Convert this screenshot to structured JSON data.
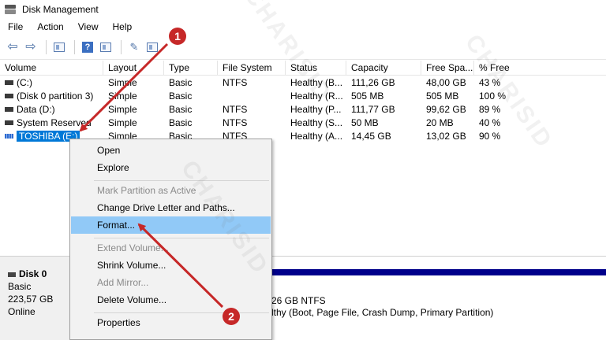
{
  "window": {
    "title": "Disk Management"
  },
  "menu": [
    "File",
    "Action",
    "View",
    "Help"
  ],
  "toolbar": {
    "buttons": [
      "back-arrow-icon",
      "forward-arrow-icon",
      "console-tree-icon",
      "help-icon",
      "properties-icon",
      "rescan-icon",
      "list-view-icon"
    ]
  },
  "columns": [
    "Volume",
    "Layout",
    "Type",
    "File System",
    "Status",
    "Capacity",
    "Free Spa...",
    "% Free"
  ],
  "rows": [
    {
      "volume": "(C:)",
      "layout": "Simple",
      "type": "Basic",
      "fs": "NTFS",
      "status": "Healthy (B...",
      "capacity": "111,26 GB",
      "free": "48,00 GB",
      "pct": "43 %"
    },
    {
      "volume": "(Disk 0 partition 3)",
      "layout": "Simple",
      "type": "Basic",
      "fs": "",
      "status": "Healthy (R...",
      "capacity": "505 MB",
      "free": "505 MB",
      "pct": "100 %"
    },
    {
      "volume": "Data (D:)",
      "layout": "Simple",
      "type": "Basic",
      "fs": "NTFS",
      "status": "Healthy (P...",
      "capacity": "111,77 GB",
      "free": "99,62 GB",
      "pct": "89 %"
    },
    {
      "volume": "System Reserved",
      "layout": "Simple",
      "type": "Basic",
      "fs": "NTFS",
      "status": "Healthy (S...",
      "capacity": "50 MB",
      "free": "20 MB",
      "pct": "40 %"
    },
    {
      "volume": "TOSHIBA (E:)",
      "layout": "Simple",
      "type": "Basic",
      "fs": "NTFS",
      "status": "Healthy (A...",
      "capacity": "14,45 GB",
      "free": "13,02 GB",
      "pct": "90 %"
    }
  ],
  "context_menu": [
    {
      "label": "Open",
      "enabled": true
    },
    {
      "label": "Explore",
      "enabled": true
    },
    {
      "label": "Mark Partition as Active",
      "enabled": false
    },
    {
      "label": "Change Drive Letter and Paths...",
      "enabled": true
    },
    {
      "label": "Format...",
      "enabled": true,
      "highlighted": true
    },
    {
      "label": "Extend Volume...",
      "enabled": false
    },
    {
      "label": "Shrink Volume...",
      "enabled": true
    },
    {
      "label": "Add Mirror...",
      "enabled": false
    },
    {
      "label": "Delete Volume...",
      "enabled": true
    },
    {
      "label": "Properties",
      "enabled": true
    }
  ],
  "disk": {
    "name": "Disk 0",
    "type": "Basic",
    "size": "223,57 GB",
    "status": "Online",
    "partition_line1": "26 GB NTFS",
    "partition_line2": "lthy (Boot, Page File, Crash Dump, Primary Partition)"
  },
  "annotations": {
    "step1": "1",
    "step2": "2",
    "color": "#c62828"
  },
  "watermark": "CHARISID"
}
